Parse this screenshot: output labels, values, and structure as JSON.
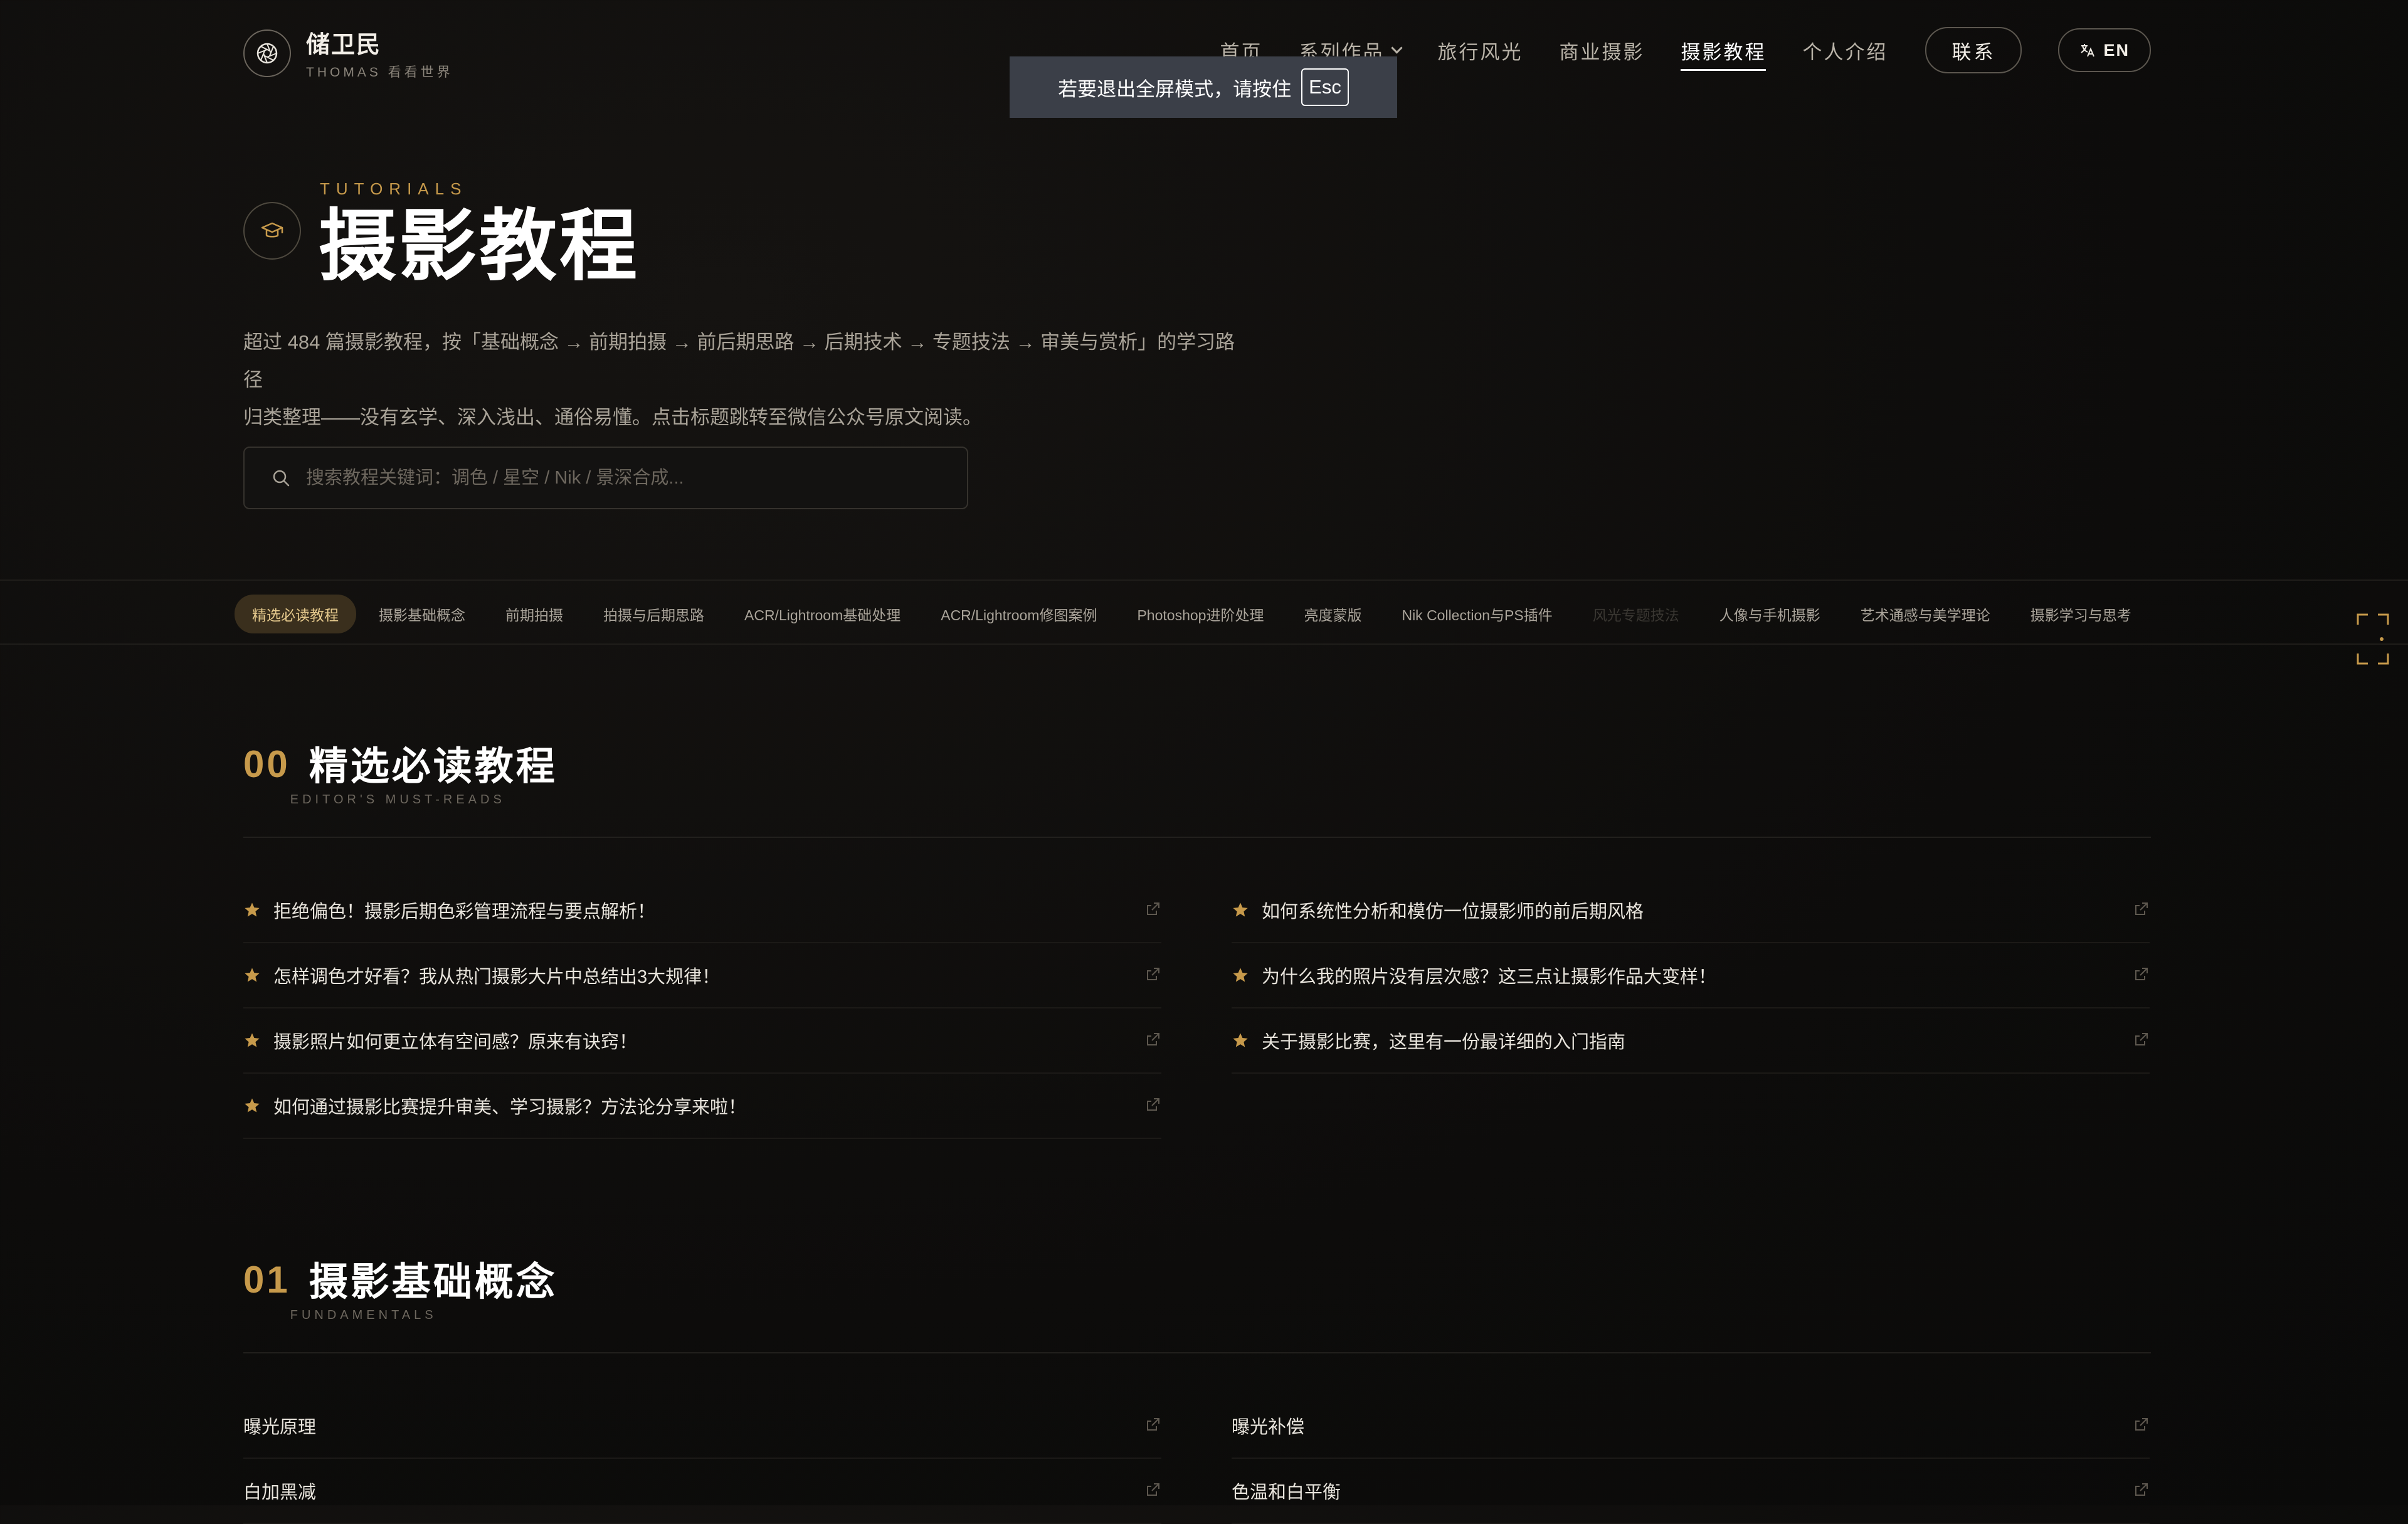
{
  "header": {
    "logo_name": "储卫民",
    "logo_sub": "THOMAS 看看世界",
    "nav": [
      {
        "label": "首页"
      },
      {
        "label": "系列作品"
      },
      {
        "label": "旅行风光"
      },
      {
        "label": "商业摄影"
      },
      {
        "label": "摄影教程"
      },
      {
        "label": "个人介绍"
      }
    ],
    "contact_label": "联系",
    "lang_label": "EN"
  },
  "toast": {
    "text": "若要退出全屏模式，请按住",
    "key": "Esc"
  },
  "hero": {
    "eyebrow": "TUTORIALS",
    "title": "摄影教程",
    "desc_line1": "超过 484 篇摄影教程，按「基础概念 → 前期拍摄 → 前后期思路 → 后期技术 → 专题技法 → 审美与赏析」的学习路径",
    "desc_line2": "归类整理——没有玄学、深入浅出、通俗易懂。点击标题跳转至微信公众号原文阅读。",
    "search_placeholder": "搜索教程关键词：调色 / 星空 / Nik / 景深合成..."
  },
  "categories": [
    {
      "label": "精选必读教程"
    },
    {
      "label": "摄影基础概念"
    },
    {
      "label": "前期拍摄"
    },
    {
      "label": "拍摄与后期思路"
    },
    {
      "label": "ACR/Lightroom基础处理"
    },
    {
      "label": "ACR/Lightroom修图案例"
    },
    {
      "label": "Photoshop进阶处理"
    },
    {
      "label": "亮度蒙版"
    },
    {
      "label": "Nik Collection与PS插件"
    },
    {
      "label": "风光专题技法"
    },
    {
      "label": "人像与手机摄影"
    },
    {
      "label": "艺术通感与美学理论"
    },
    {
      "label": "摄影学习与思考"
    }
  ],
  "sections": [
    {
      "num": "00",
      "title": "精选必读教程",
      "subtitle": "EDITOR'S MUST-READS",
      "left": [
        {
          "title": "拒绝偏色！摄影后期色彩管理流程与要点解析！"
        },
        {
          "title": "怎样调色才好看？我从热门摄影大片中总结出3大规律！"
        },
        {
          "title": "摄影照片如何更立体有空间感？原来有诀窍！"
        },
        {
          "title": "如何通过摄影比赛提升审美、学习摄影？方法论分享来啦！"
        }
      ],
      "right": [
        {
          "title": "如何系统性分析和模仿一位摄影师的前后期风格"
        },
        {
          "title": "为什么我的照片没有层次感？这三点让摄影作品大变样！"
        },
        {
          "title": "关于摄影比赛，这里有一份最详细的入门指南"
        }
      ]
    },
    {
      "num": "01",
      "title": "摄影基础概念",
      "subtitle": "FUNDAMENTALS",
      "left": [
        {
          "title": "曝光原理"
        },
        {
          "title": "白加黑减"
        }
      ],
      "right": [
        {
          "title": "曝光补偿"
        },
        {
          "title": "色温和白平衡"
        }
      ]
    }
  ],
  "colors": {
    "accent": "#c79a4b",
    "background": "#0d0c0b",
    "text": "#e8e4dc"
  }
}
